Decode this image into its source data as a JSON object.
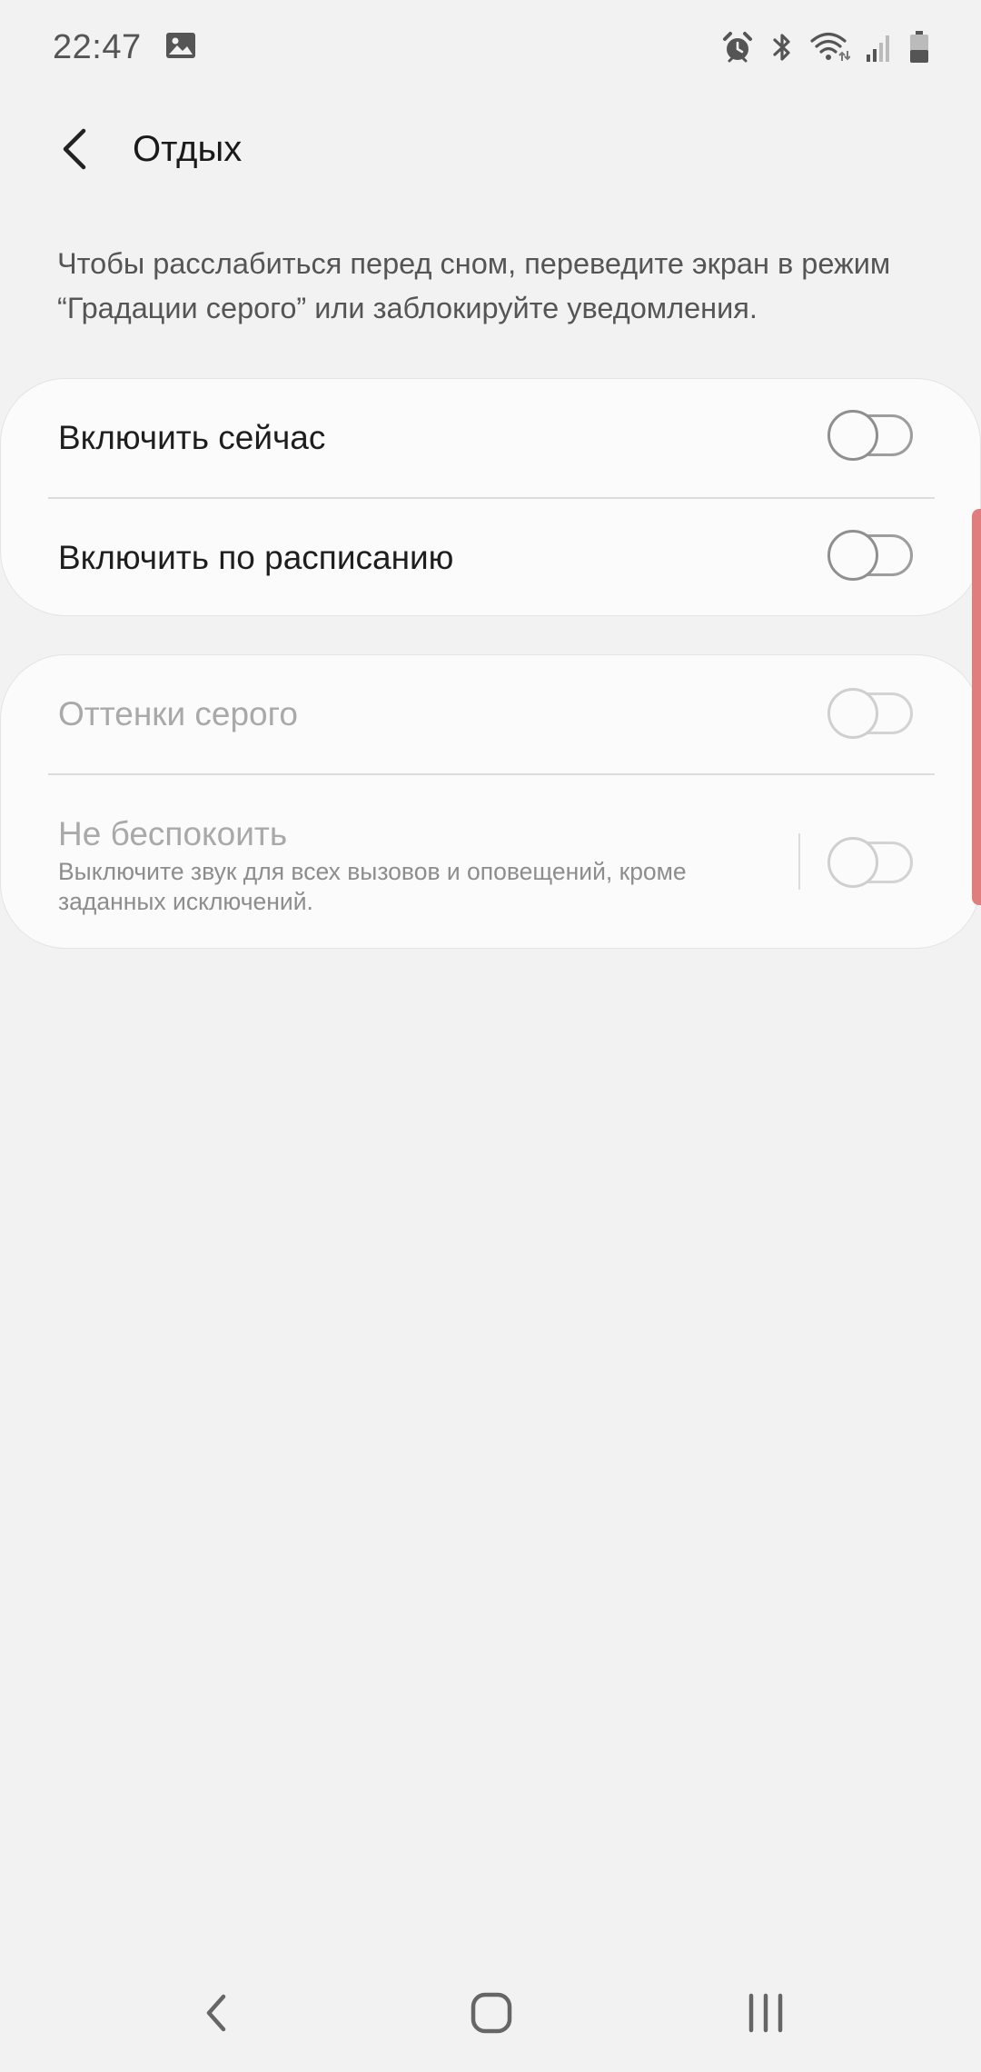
{
  "status_bar": {
    "time": "22:47",
    "left_icons": [
      "gallery-icon"
    ],
    "right_icons": [
      "alarm-icon",
      "bluetooth-icon",
      "wifi-icon",
      "signal-icon",
      "battery-icon"
    ]
  },
  "app_bar": {
    "title": "Отдых",
    "back_icon": "chevron-left-icon"
  },
  "description": "Чтобы расслабиться перед сном, переведите экран в режим “Градации серого” или заблокируйте уведомления.",
  "card_1": {
    "items": [
      {
        "label": "Включить сейчас",
        "enabled": false
      },
      {
        "label": "Включить по расписанию",
        "enabled": false
      }
    ]
  },
  "card_2": {
    "grayscale": {
      "label": "Оттенки серого",
      "enabled": false,
      "disabled": true
    },
    "dnd": {
      "label": "Не беспокоить",
      "description": "Выключите звук для всех вызовов и оповещений, кроме заданных исключений.",
      "enabled": false,
      "disabled": true
    }
  },
  "nav_bar": {
    "items": [
      "back-icon",
      "home-icon",
      "recents-icon"
    ]
  },
  "colors": {
    "background": "#f2f2f2",
    "card": "#fbfbfb",
    "edge_handle": "#e07e7e"
  }
}
